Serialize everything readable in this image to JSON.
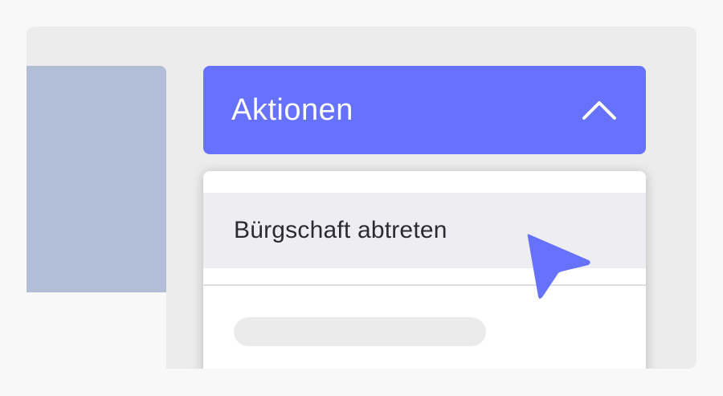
{
  "actions_button": {
    "label": "Aktionen",
    "icon": "chevron-up-icon",
    "color": "#6672fc"
  },
  "dropdown": {
    "items": [
      {
        "label": "Bürgschaft abtreten",
        "state": "hover"
      }
    ]
  },
  "side_panel": {
    "color": "#b1bed6"
  },
  "cursor": {
    "icon": "mouse-pointer-icon",
    "color": "#6672fc"
  }
}
